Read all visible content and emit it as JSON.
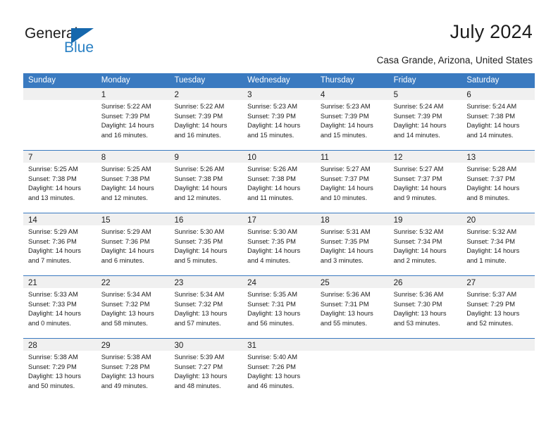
{
  "brand": {
    "name_part1": "General",
    "name_part2": "Blue",
    "logo_icon": "triangle-logo-icon",
    "accent_color": "#2980c4",
    "triangle_color": "#1668ad"
  },
  "header": {
    "title": "July 2024",
    "location": "Casa Grande, Arizona, United States"
  },
  "calendar": {
    "header_color": "#3a7ac0",
    "daynum_band_color": "#f0f0f0",
    "day_names": [
      "Sunday",
      "Monday",
      "Tuesday",
      "Wednesday",
      "Thursday",
      "Friday",
      "Saturday"
    ],
    "weeks": [
      [
        {
          "day": "",
          "empty": true,
          "sunrise": "",
          "sunset": "",
          "daylight_line1": "",
          "daylight_line2": ""
        },
        {
          "day": "1",
          "sunrise": "Sunrise: 5:22 AM",
          "sunset": "Sunset: 7:39 PM",
          "daylight_line1": "Daylight: 14 hours",
          "daylight_line2": "and 16 minutes."
        },
        {
          "day": "2",
          "sunrise": "Sunrise: 5:22 AM",
          "sunset": "Sunset: 7:39 PM",
          "daylight_line1": "Daylight: 14 hours",
          "daylight_line2": "and 16 minutes."
        },
        {
          "day": "3",
          "sunrise": "Sunrise: 5:23 AM",
          "sunset": "Sunset: 7:39 PM",
          "daylight_line1": "Daylight: 14 hours",
          "daylight_line2": "and 15 minutes."
        },
        {
          "day": "4",
          "sunrise": "Sunrise: 5:23 AM",
          "sunset": "Sunset: 7:39 PM",
          "daylight_line1": "Daylight: 14 hours",
          "daylight_line2": "and 15 minutes."
        },
        {
          "day": "5",
          "sunrise": "Sunrise: 5:24 AM",
          "sunset": "Sunset: 7:39 PM",
          "daylight_line1": "Daylight: 14 hours",
          "daylight_line2": "and 14 minutes."
        },
        {
          "day": "6",
          "sunrise": "Sunrise: 5:24 AM",
          "sunset": "Sunset: 7:38 PM",
          "daylight_line1": "Daylight: 14 hours",
          "daylight_line2": "and 14 minutes."
        }
      ],
      [
        {
          "day": "7",
          "sunrise": "Sunrise: 5:25 AM",
          "sunset": "Sunset: 7:38 PM",
          "daylight_line1": "Daylight: 14 hours",
          "daylight_line2": "and 13 minutes."
        },
        {
          "day": "8",
          "sunrise": "Sunrise: 5:25 AM",
          "sunset": "Sunset: 7:38 PM",
          "daylight_line1": "Daylight: 14 hours",
          "daylight_line2": "and 12 minutes."
        },
        {
          "day": "9",
          "sunrise": "Sunrise: 5:26 AM",
          "sunset": "Sunset: 7:38 PM",
          "daylight_line1": "Daylight: 14 hours",
          "daylight_line2": "and 12 minutes."
        },
        {
          "day": "10",
          "sunrise": "Sunrise: 5:26 AM",
          "sunset": "Sunset: 7:38 PM",
          "daylight_line1": "Daylight: 14 hours",
          "daylight_line2": "and 11 minutes."
        },
        {
          "day": "11",
          "sunrise": "Sunrise: 5:27 AM",
          "sunset": "Sunset: 7:37 PM",
          "daylight_line1": "Daylight: 14 hours",
          "daylight_line2": "and 10 minutes."
        },
        {
          "day": "12",
          "sunrise": "Sunrise: 5:27 AM",
          "sunset": "Sunset: 7:37 PM",
          "daylight_line1": "Daylight: 14 hours",
          "daylight_line2": "and 9 minutes."
        },
        {
          "day": "13",
          "sunrise": "Sunrise: 5:28 AM",
          "sunset": "Sunset: 7:37 PM",
          "daylight_line1": "Daylight: 14 hours",
          "daylight_line2": "and 8 minutes."
        }
      ],
      [
        {
          "day": "14",
          "sunrise": "Sunrise: 5:29 AM",
          "sunset": "Sunset: 7:36 PM",
          "daylight_line1": "Daylight: 14 hours",
          "daylight_line2": "and 7 minutes."
        },
        {
          "day": "15",
          "sunrise": "Sunrise: 5:29 AM",
          "sunset": "Sunset: 7:36 PM",
          "daylight_line1": "Daylight: 14 hours",
          "daylight_line2": "and 6 minutes."
        },
        {
          "day": "16",
          "sunrise": "Sunrise: 5:30 AM",
          "sunset": "Sunset: 7:35 PM",
          "daylight_line1": "Daylight: 14 hours",
          "daylight_line2": "and 5 minutes."
        },
        {
          "day": "17",
          "sunrise": "Sunrise: 5:30 AM",
          "sunset": "Sunset: 7:35 PM",
          "daylight_line1": "Daylight: 14 hours",
          "daylight_line2": "and 4 minutes."
        },
        {
          "day": "18",
          "sunrise": "Sunrise: 5:31 AM",
          "sunset": "Sunset: 7:35 PM",
          "daylight_line1": "Daylight: 14 hours",
          "daylight_line2": "and 3 minutes."
        },
        {
          "day": "19",
          "sunrise": "Sunrise: 5:32 AM",
          "sunset": "Sunset: 7:34 PM",
          "daylight_line1": "Daylight: 14 hours",
          "daylight_line2": "and 2 minutes."
        },
        {
          "day": "20",
          "sunrise": "Sunrise: 5:32 AM",
          "sunset": "Sunset: 7:34 PM",
          "daylight_line1": "Daylight: 14 hours",
          "daylight_line2": "and 1 minute."
        }
      ],
      [
        {
          "day": "21",
          "sunrise": "Sunrise: 5:33 AM",
          "sunset": "Sunset: 7:33 PM",
          "daylight_line1": "Daylight: 14 hours",
          "daylight_line2": "and 0 minutes."
        },
        {
          "day": "22",
          "sunrise": "Sunrise: 5:34 AM",
          "sunset": "Sunset: 7:32 PM",
          "daylight_line1": "Daylight: 13 hours",
          "daylight_line2": "and 58 minutes."
        },
        {
          "day": "23",
          "sunrise": "Sunrise: 5:34 AM",
          "sunset": "Sunset: 7:32 PM",
          "daylight_line1": "Daylight: 13 hours",
          "daylight_line2": "and 57 minutes."
        },
        {
          "day": "24",
          "sunrise": "Sunrise: 5:35 AM",
          "sunset": "Sunset: 7:31 PM",
          "daylight_line1": "Daylight: 13 hours",
          "daylight_line2": "and 56 minutes."
        },
        {
          "day": "25",
          "sunrise": "Sunrise: 5:36 AM",
          "sunset": "Sunset: 7:31 PM",
          "daylight_line1": "Daylight: 13 hours",
          "daylight_line2": "and 55 minutes."
        },
        {
          "day": "26",
          "sunrise": "Sunrise: 5:36 AM",
          "sunset": "Sunset: 7:30 PM",
          "daylight_line1": "Daylight: 13 hours",
          "daylight_line2": "and 53 minutes."
        },
        {
          "day": "27",
          "sunrise": "Sunrise: 5:37 AM",
          "sunset": "Sunset: 7:29 PM",
          "daylight_line1": "Daylight: 13 hours",
          "daylight_line2": "and 52 minutes."
        }
      ],
      [
        {
          "day": "28",
          "sunrise": "Sunrise: 5:38 AM",
          "sunset": "Sunset: 7:29 PM",
          "daylight_line1": "Daylight: 13 hours",
          "daylight_line2": "and 50 minutes."
        },
        {
          "day": "29",
          "sunrise": "Sunrise: 5:38 AM",
          "sunset": "Sunset: 7:28 PM",
          "daylight_line1": "Daylight: 13 hours",
          "daylight_line2": "and 49 minutes."
        },
        {
          "day": "30",
          "sunrise": "Sunrise: 5:39 AM",
          "sunset": "Sunset: 7:27 PM",
          "daylight_line1": "Daylight: 13 hours",
          "daylight_line2": "and 48 minutes."
        },
        {
          "day": "31",
          "sunrise": "Sunrise: 5:40 AM",
          "sunset": "Sunset: 7:26 PM",
          "daylight_line1": "Daylight: 13 hours",
          "daylight_line2": "and 46 minutes."
        },
        {
          "day": "",
          "empty": true,
          "sunrise": "",
          "sunset": "",
          "daylight_line1": "",
          "daylight_line2": ""
        },
        {
          "day": "",
          "empty": true,
          "sunrise": "",
          "sunset": "",
          "daylight_line1": "",
          "daylight_line2": ""
        },
        {
          "day": "",
          "empty": true,
          "sunrise": "",
          "sunset": "",
          "daylight_line1": "",
          "daylight_line2": ""
        }
      ]
    ]
  }
}
